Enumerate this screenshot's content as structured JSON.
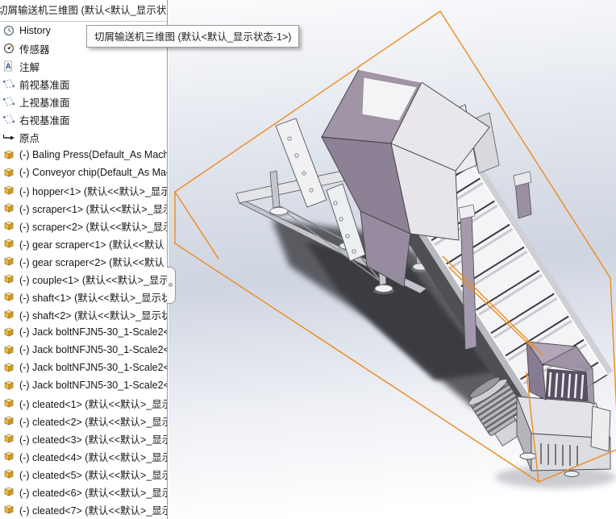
{
  "window": {
    "root_item_label": "切屑输送机三维图  (默认<默认_显示状态",
    "tooltip_text": "切屑输送机三维图  (默认<默认_显示状态-1>)"
  },
  "tree": {
    "items": [
      {
        "label": "History",
        "icon": "history-icon"
      },
      {
        "label": "传感器",
        "icon": "sensor-icon"
      },
      {
        "label": "注解",
        "icon": "annotation-icon"
      },
      {
        "label": "前视基准面",
        "icon": "plane-icon"
      },
      {
        "label": "上视基准面",
        "icon": "plane-icon"
      },
      {
        "label": "右视基准面",
        "icon": "plane-icon"
      },
      {
        "label": "原点",
        "icon": "origin-icon"
      },
      {
        "label": "(-) Baling Press(Default_As Machi",
        "icon": "part-icon"
      },
      {
        "label": "(-) Conveyor chip(Default_As Mac",
        "icon": "part-icon"
      },
      {
        "label": "(-) hopper<1> (默认<<默认>_显示",
        "icon": "part-icon"
      },
      {
        "label": "(-) scraper<1> (默认<<默认>_显示",
        "icon": "part-icon"
      },
      {
        "label": "(-) scraper<2> (默认<<默认>_显示",
        "icon": "part-icon"
      },
      {
        "label": "(-) gear scraper<1> (默认<<默认",
        "icon": "part-icon"
      },
      {
        "label": "(-) gear scraper<2> (默认<<默认",
        "icon": "part-icon"
      },
      {
        "label": "(-) couple<1> (默认<<默认>_显示",
        "icon": "part-icon"
      },
      {
        "label": "(-) shaft<1> (默认<<默认>_显示状",
        "icon": "part-icon"
      },
      {
        "label": "(-) shaft<2> (默认<<默认>_显示状",
        "icon": "part-icon"
      },
      {
        "label": "(-) Jack boltNFJN5-30_1-Scale2<",
        "icon": "part-icon"
      },
      {
        "label": "(-) Jack boltNFJN5-30_1-Scale2<",
        "icon": "part-icon"
      },
      {
        "label": "(-) Jack boltNFJN5-30_1-Scale2<",
        "icon": "part-icon"
      },
      {
        "label": "(-) Jack boltNFJN5-30_1-Scale2<",
        "icon": "part-icon"
      },
      {
        "label": "(-) cleated<1> (默认<<默认>_显示",
        "icon": "part-icon"
      },
      {
        "label": "(-) cleated<2> (默认<<默认>_显示",
        "icon": "part-icon"
      },
      {
        "label": "(-) cleated<3> (默认<<默认>_显示",
        "icon": "part-icon"
      },
      {
        "label": "(-) cleated<4> (默认<<默认>_显示",
        "icon": "part-icon"
      },
      {
        "label": "(-) cleated<5> (默认<<默认>_显示",
        "icon": "part-icon"
      },
      {
        "label": "(-) cleated<6> (默认<<默认>_显示",
        "icon": "part-icon"
      },
      {
        "label": "(-) cleated<7> (默认<<默认>_显示",
        "icon": "part-icon"
      }
    ]
  },
  "viewport": {
    "selection_box_color": "#EE8A1C",
    "hopper_color": "#9B8FA1",
    "metal_light": "#D9DADE",
    "metal_dark": "#4D4E54",
    "belt_color": "#F4F4F6",
    "background_mid": "#CFD5E1"
  }
}
